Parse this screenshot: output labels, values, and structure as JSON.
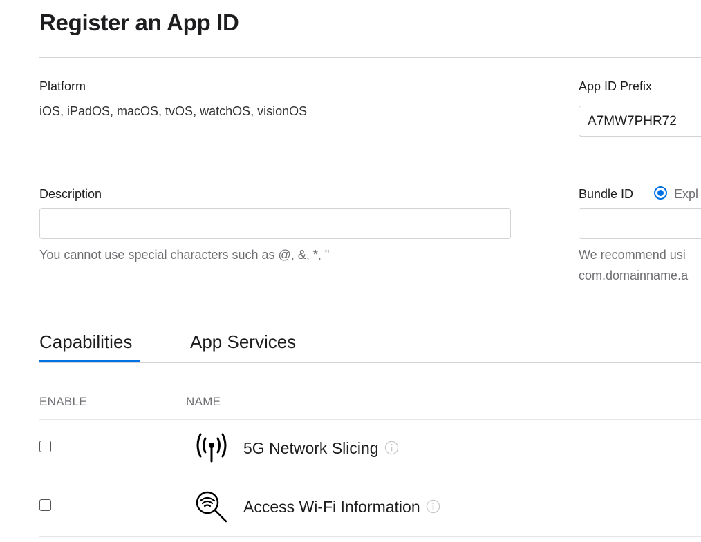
{
  "header": {
    "title": "Register an App ID"
  },
  "platform": {
    "label": "Platform",
    "value": "iOS, iPadOS, macOS, tvOS, watchOS, visionOS"
  },
  "app_id_prefix": {
    "label": "App ID Prefix",
    "value": "A7MW7PHR72"
  },
  "description": {
    "label": "Description",
    "value": "",
    "placeholder": "",
    "help": "You cannot use special characters such as @, &, *, \""
  },
  "bundle_id": {
    "label": "Bundle ID",
    "radio_label": "Expl",
    "value": "",
    "help_line1": "We recommend usi",
    "help_line2": "com.domainname.a"
  },
  "tabs": [
    {
      "label": "Capabilities",
      "active": true
    },
    {
      "label": "App Services",
      "active": false
    }
  ],
  "table": {
    "columns": [
      "ENABLE",
      "NAME"
    ],
    "rows": [
      {
        "name": "5G Network Slicing",
        "enabled": false,
        "icon": "antenna-icon"
      },
      {
        "name": "Access Wi-Fi Information",
        "enabled": false,
        "icon": "wifi-search-icon"
      }
    ]
  },
  "colors": {
    "accent": "#0071e3",
    "text": "#1d1d1f",
    "secondary_text": "#6e6e73",
    "rule": "#d2d2d7"
  }
}
